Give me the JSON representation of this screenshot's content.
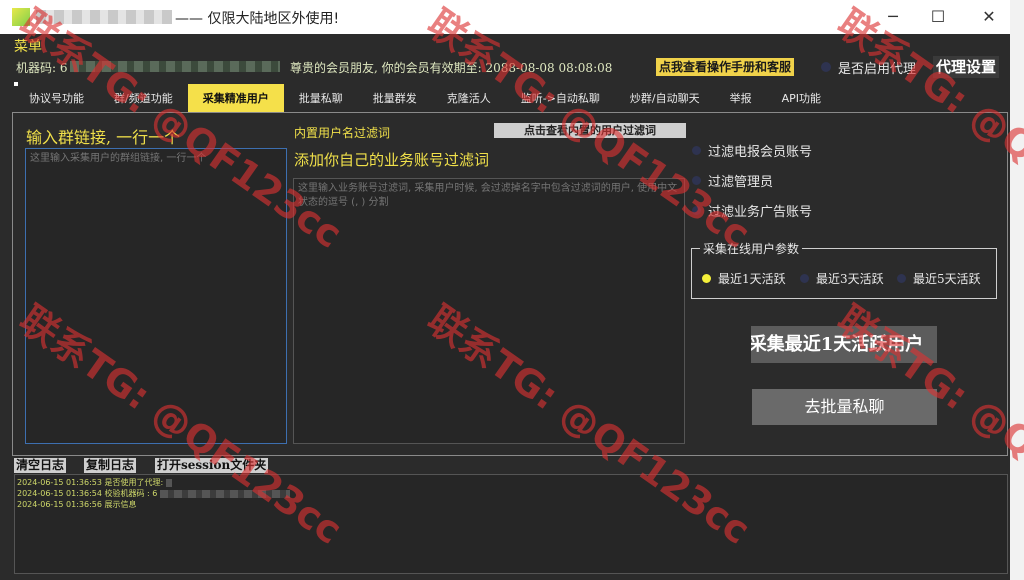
{
  "window": {
    "title": "—— 仅限大陆地区外使用!",
    "minimize_glyph": "─",
    "maximize_glyph": "☐",
    "close_glyph": "✕"
  },
  "header": {
    "menu_label": "菜单",
    "machine_code_label": "机器码: 6",
    "member_text": "尊贵的会员朋友, 你的会员有效期至: 2088-08-08 08:08:08",
    "manual_button": "点我查看操作手册和客服",
    "proxy_toggle_label": "是否启用代理",
    "proxy_settings_button": "代理设置"
  },
  "tabs": [
    {
      "label": "协议号功能"
    },
    {
      "label": "群/频道功能"
    },
    {
      "label": "采集精准用户",
      "active": true
    },
    {
      "label": "批量私聊"
    },
    {
      "label": "批量群发"
    },
    {
      "label": "克隆活人"
    },
    {
      "label": "监听->自动私聊"
    },
    {
      "label": "炒群/自动聊天"
    },
    {
      "label": "举报"
    },
    {
      "label": "API功能"
    }
  ],
  "collect": {
    "group_link_label": "输入群链接, 一行一个",
    "group_link_placeholder": "这里输入采集用户的群组链接, 一行一个",
    "builtin_filter_label": "内置用户名过滤词",
    "builtin_filter_button": "点击查看内置的用户过滤词",
    "custom_filter_label": "添加你自己的业务账号过滤词",
    "custom_filter_placeholder": "这里输入业务账号过滤词, 采集用户时候, 会过滤掉名字中包含过滤词的用户, 使用中文状态的逗号 (, ) 分割",
    "filter_options": [
      {
        "label": "过滤电报会员账号",
        "checked": false
      },
      {
        "label": "过滤管理员",
        "checked": false
      },
      {
        "label": "过滤业务广告账号",
        "checked": false
      }
    ],
    "online_params_title": "采集在线用户参数",
    "online_options": [
      {
        "label": "最近1天活跃",
        "selected": true
      },
      {
        "label": "最近3天活跃",
        "selected": false
      },
      {
        "label": "最近5天活跃",
        "selected": false
      }
    ],
    "collect_button": "采集最近1天活跃用户",
    "bulk_pm_button": "去批量私聊"
  },
  "log": {
    "clear_button": "清空日志",
    "copy_button": "复制日志",
    "open_session_button": "打开session文件夹",
    "lines": [
      "2024-06-15 01:36:53 是否使用了代理:",
      "2024-06-15 01:36:54 校验机器码 : 6",
      "2024-06-15 01:36:56 展示信息"
    ]
  },
  "watermark": {
    "text": "联系TG: @QF123cc"
  },
  "colors": {
    "accent_yellow": "#f5e04a",
    "app_background": "#2b2b2b",
    "watermark_red": "#dc3232"
  }
}
